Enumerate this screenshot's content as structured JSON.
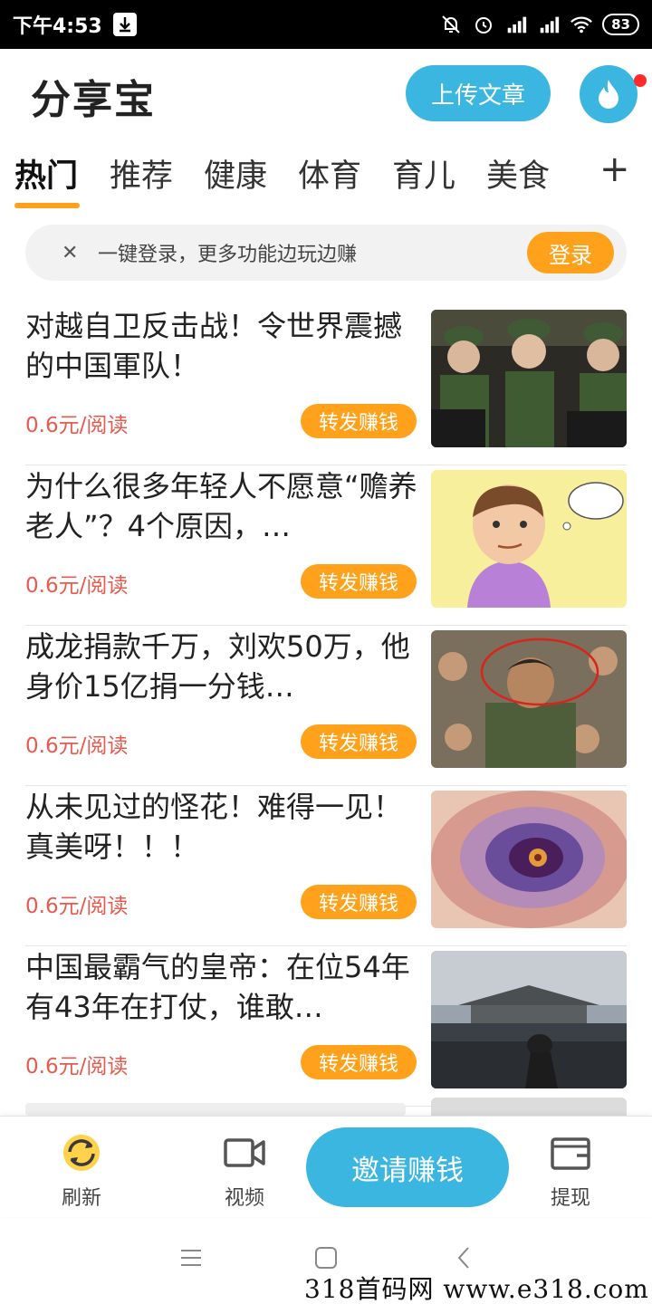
{
  "status_bar": {
    "time": "下午4:53",
    "battery": "83"
  },
  "header": {
    "title": "分享宝",
    "upload_label": "上传文章"
  },
  "tabs": [
    {
      "label": "热门"
    },
    {
      "label": "推荐"
    },
    {
      "label": "健康"
    },
    {
      "label": "体育"
    },
    {
      "label": "育儿"
    },
    {
      "label": "美食"
    }
  ],
  "tabs_add": "+",
  "login_banner": {
    "close": "✕",
    "text": "一键登录，更多功能边玩边赚",
    "button": "登录"
  },
  "articles": [
    {
      "title": "对越自卫反击战！令世界震撼的中国軍队！",
      "price": "0.6元/阅读",
      "share": "转发赚钱"
    },
    {
      "title": "为什么很多年轻人不愿意“赡养老人”？4个原因，…",
      "price": "0.6元/阅读",
      "share": "转发赚钱"
    },
    {
      "title": "成龙捐款千万，刘欢50万，他身价15亿捐一分钱…",
      "price": "0.6元/阅读",
      "share": "转发赚钱"
    },
    {
      "title": "从未见过的怪花！难得一见！真美呀！！！",
      "price": "0.6元/阅读",
      "share": "转发赚钱"
    },
    {
      "title": "中国最霸气的皇帝：在位54年有43年在打仗，谁敢…",
      "price": "0.6元/阅读",
      "share": "转发赚钱"
    }
  ],
  "bottom_nav": {
    "refresh": "刷新",
    "video": "视频",
    "invite": "邀请赚钱",
    "withdraw": "提现"
  },
  "colors": {
    "accent_blue": "#3bb6e0",
    "accent_orange": "#ffa11a",
    "price_red": "#e85a4f"
  },
  "watermark": "318首码网 www.e318.com"
}
